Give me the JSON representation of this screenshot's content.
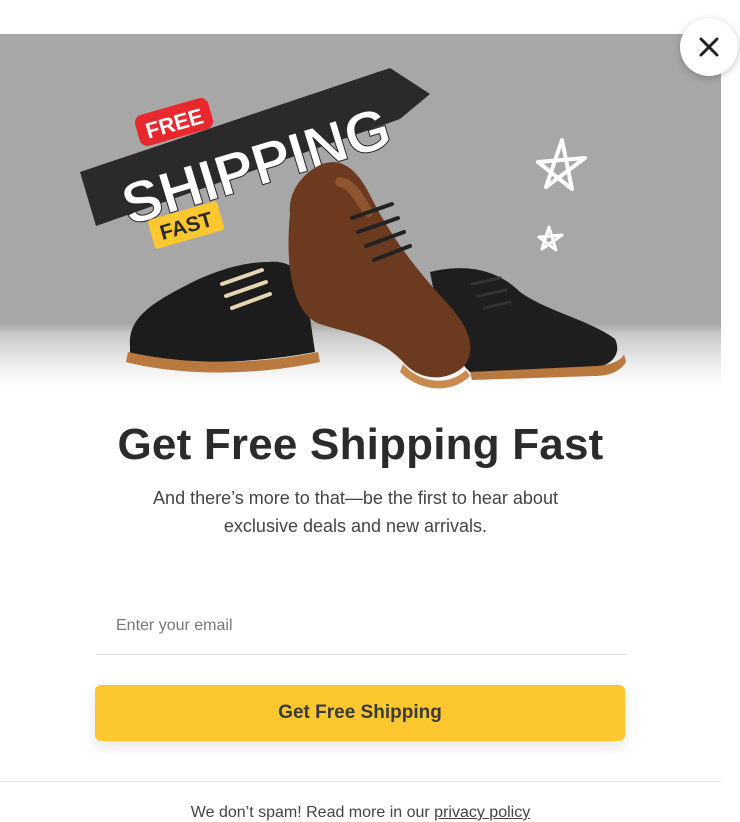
{
  "hero": {
    "badge_free": "FREE",
    "badge_shipping": "SHIPPING",
    "badge_fast": "FAST",
    "image_icon": "shoes-product-image"
  },
  "close": {
    "icon": "close-icon",
    "label": "✕"
  },
  "title": "Get Free Shipping Fast",
  "subtitle": "And there’s more to that—be the first to hear about exclusive deals and new arrivals.",
  "email": {
    "placeholder": "Enter your email",
    "value": ""
  },
  "cta_label": "Get Free Shipping",
  "footer": {
    "text": "We don’t spam! Read more in our ",
    "link_label": "privacy policy"
  },
  "colors": {
    "accent": "#fdc72f",
    "badge_red": "#e8282d",
    "badge_dark": "#2a2a2a",
    "hero_bg": "#a7a7a7"
  }
}
